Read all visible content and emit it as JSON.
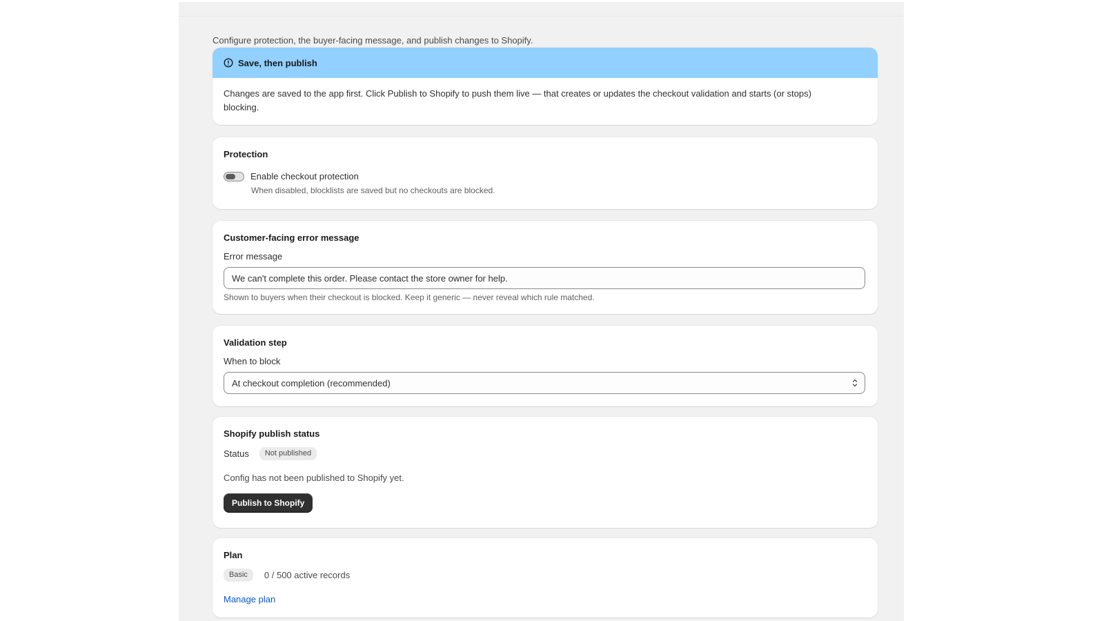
{
  "page": {
    "intro": "Configure protection, the buyer-facing message, and publish changes to Shopify."
  },
  "banner": {
    "title": "Save, then publish",
    "body": "Changes are saved to the app first. Click Publish to Shopify to push them live — that creates or updates the checkout validation and starts (or stops) blocking.",
    "color": "#91d0ff",
    "icon": "info-icon"
  },
  "protection": {
    "title": "Protection",
    "toggle_label": "Enable checkout protection",
    "toggle_help": "When disabled, blocklists are saved but no checkouts are blocked.",
    "enabled": false
  },
  "error_message": {
    "title": "Customer-facing error message",
    "field_label": "Error message",
    "value": "We can't complete this order. Please contact the store owner for help.",
    "help": "Shown to buyers when their checkout is blocked. Keep it generic — never reveal which rule matched."
  },
  "validation": {
    "title": "Validation step",
    "field_label": "When to block",
    "selected": "At checkout completion (recommended)"
  },
  "publish": {
    "title": "Shopify publish status",
    "status_label": "Status",
    "status_badge": "Not published",
    "status_text": "Config has not been published to Shopify yet.",
    "button_label": "Publish to Shopify"
  },
  "plan": {
    "title": "Plan",
    "badge": "Basic",
    "records": "0 / 500 active records",
    "link_label": "Manage plan",
    "link_color": "#005bd3"
  }
}
